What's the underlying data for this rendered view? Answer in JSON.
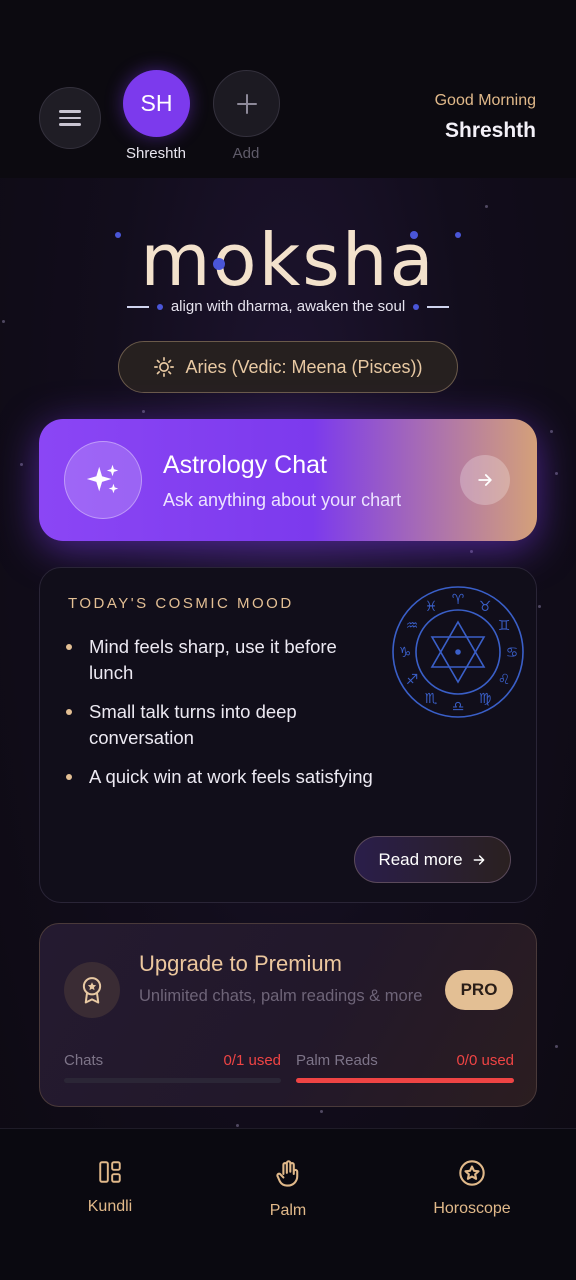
{
  "header": {
    "menu_icon": "hamburger-icon",
    "profile": {
      "initials": "SH",
      "name": "Shreshth"
    },
    "add_profile": {
      "icon": "plus-icon",
      "label": "Add"
    },
    "greeting": "Good Morning",
    "user_name": "Shreshth"
  },
  "brand": {
    "name": "moksha",
    "tagline": "align with dharma, awaken the soul"
  },
  "sign": {
    "icon": "sun-icon",
    "text": "Aries (Vedic: Meena (Pisces))"
  },
  "chat_card": {
    "icon": "sparkles-icon",
    "title": "Astrology Chat",
    "subtitle": "Ask anything about your chart",
    "arrow_icon": "arrow-right-icon"
  },
  "mood": {
    "title": "TODAY'S COSMIC MOOD",
    "items": [
      "Mind feels sharp, use it before lunch",
      "Small talk turns into deep conversation",
      "A quick win at work feels satisfying"
    ],
    "wheel_icon": "zodiac-wheel-icon",
    "read_more": "Read more"
  },
  "premium": {
    "icon": "award-badge-icon",
    "title": "Upgrade to Premium",
    "subtitle": "Unlimited chats, palm readings & more",
    "badge": "PRO",
    "usage": [
      {
        "label": "Chats",
        "value": "0/1 used",
        "fill_fraction": 0
      },
      {
        "label": "Palm Reads",
        "value": "0/0 used",
        "fill_fraction": 1
      }
    ]
  },
  "nav": [
    {
      "icon": "kundli-layout-icon",
      "label": "Kundli"
    },
    {
      "icon": "palm-hand-icon",
      "label": "Palm"
    },
    {
      "icon": "star-circle-icon",
      "label": "Horoscope"
    }
  ],
  "colors": {
    "accent_purple": "#7c3aed",
    "accent_gold": "#e3bf94",
    "danger_red": "#ef4444",
    "background": "#120d1c"
  }
}
